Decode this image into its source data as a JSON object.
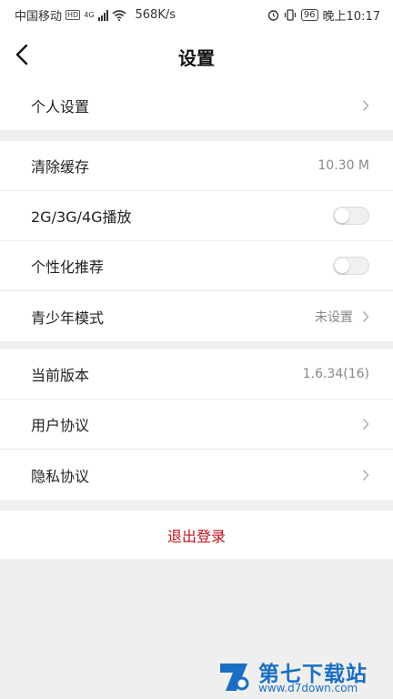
{
  "status_bar": {
    "carrier": "中国移动",
    "hd": "HD",
    "network": "4G",
    "speed": "568K/s",
    "battery": "96",
    "time": "晚上10:17"
  },
  "header": {
    "title": "设置",
    "back_icon": "chevron-left-icon"
  },
  "sections": {
    "personal": {
      "items": [
        {
          "label": "个人设置"
        }
      ]
    },
    "general": {
      "items": [
        {
          "label": "清除缓存",
          "value": "10.30 M"
        },
        {
          "label": "2G/3G/4G播放",
          "toggle": false
        },
        {
          "label": "个性化推荐",
          "toggle": false
        },
        {
          "label": "青少年模式",
          "value": "未设置"
        }
      ]
    },
    "about": {
      "items": [
        {
          "label": "当前版本",
          "value": "1.6.34(16)"
        },
        {
          "label": "用户协议"
        },
        {
          "label": "隐私协议"
        }
      ]
    }
  },
  "logout": {
    "label": "退出登录",
    "color": "#c0121b"
  },
  "watermark": {
    "text": "第七下载站",
    "url": "www.d7down.com",
    "color": "#1a6fc4"
  }
}
